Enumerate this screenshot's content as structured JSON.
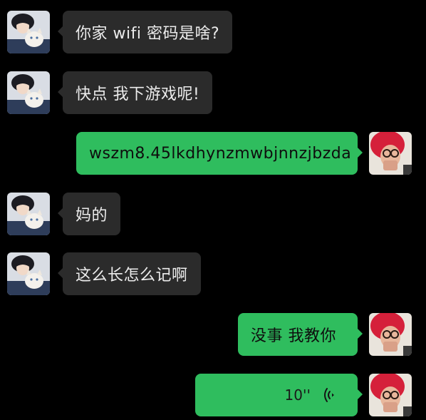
{
  "messages": [
    {
      "side": "left",
      "type": "text",
      "text": "你家 wifi 密码是啥?"
    },
    {
      "side": "left",
      "type": "text",
      "text": "快点 我下游戏呢!"
    },
    {
      "side": "right",
      "type": "text",
      "text": "wszm8.45lkdhynzmwbjnnzjbzda"
    },
    {
      "side": "left",
      "type": "text",
      "text": "妈的"
    },
    {
      "side": "left",
      "type": "text",
      "text": "这么长怎么记啊"
    },
    {
      "side": "right",
      "type": "text",
      "text": "没事 我教你"
    },
    {
      "side": "right",
      "type": "voice",
      "duration": "10''",
      "icon": "voice-wave-icon"
    }
  ],
  "colors": {
    "background": "#000000",
    "incoming_bubble": "#2b2b2b",
    "outgoing_bubble": "#2fbd5e"
  }
}
